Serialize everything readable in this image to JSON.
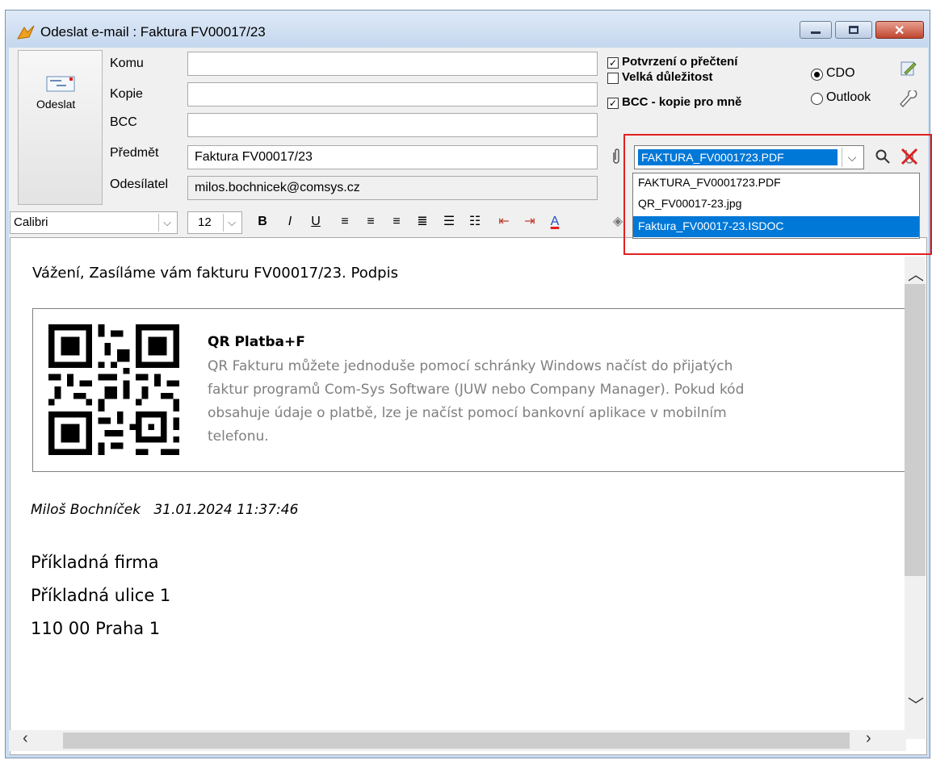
{
  "window": {
    "title": "Odeslat e-mail : Faktura FV00017/23"
  },
  "send_button": {
    "label": "Odeslat"
  },
  "fields": {
    "to": {
      "label": "Komu",
      "value": ""
    },
    "cc": {
      "label": "Kopie",
      "value": ""
    },
    "bcc": {
      "label": "BCC",
      "value": ""
    },
    "subject": {
      "label": "Předmět",
      "value": "Faktura FV00017/23"
    },
    "sender": {
      "label": "Odesílatel",
      "value": "milos.bochnicek@comsys.cz"
    }
  },
  "options": {
    "read_receipt": {
      "label": "Potvrzení o přečtení",
      "checked": true
    },
    "high_importance": {
      "label": "Velká důležitost",
      "checked": false
    },
    "bcc_self": {
      "label": "BCC - kopie pro mně",
      "checked": true
    }
  },
  "client_choice": {
    "cdo": {
      "label": "CDO",
      "selected": true
    },
    "outlook": {
      "label": "Outlook",
      "selected": false
    }
  },
  "attachments": {
    "selected": "FAKTURA_FV0001723.PDF",
    "options": [
      "FAKTURA_FV0001723.PDF",
      "QR_FV00017-23.jpg",
      "Faktura_FV00017-23.ISDOC"
    ],
    "highlighted_index": 2
  },
  "toolbar": {
    "font": "Calibri",
    "size": "12",
    "bold": "B",
    "italic": "I",
    "underline": "U"
  },
  "colors": {
    "highlight": "#0078d7",
    "red_frame": "#e02020",
    "qr_text_gray": "#7f7f7f"
  },
  "email_body": {
    "greeting": "Vážení, Zasíláme vám fakturu FV00017/23. Podpis",
    "qr_title": "QR Platba+F",
    "qr_lines": [
      "QR Fakturu můžete jednoduše pomocí schránky Windows načíst do přijatých",
      "faktur programů Com-Sys Software (JUW nebo Company Manager). Pokud kód",
      "obsahuje údaje o platbě, lze je načíst pomocí bankovní aplikace v mobilním",
      "telefonu."
    ],
    "signature": "Miloš Bochníček   31.01.2024 11:37:46",
    "address": [
      "Příkladná firma",
      "Příkladná ulice 1",
      "110 00 Praha 1"
    ]
  }
}
